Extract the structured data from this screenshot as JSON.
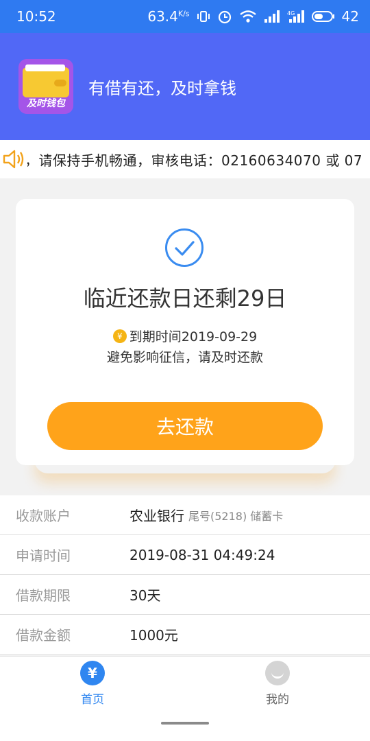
{
  "status_bar": {
    "time": "10:52",
    "network_speed": "63.4",
    "speed_unit": "K/s",
    "battery": "42"
  },
  "header": {
    "logo_text": "及时钱包",
    "slogan": "有借有还，及时拿钱"
  },
  "notice": {
    "text": "，请保持手机畅通，审核电话：02160634070 或 07"
  },
  "card": {
    "title": "临近还款日还剩29日",
    "due_label": "到期时间2019-09-29",
    "warning": "避免影响征信，请及时还款",
    "repay_button": "去还款"
  },
  "info": {
    "rows": [
      {
        "label": "收款账户",
        "value": "农业银行",
        "sub": "尾号(5218) 储蓄卡"
      },
      {
        "label": "申请时间",
        "value": "2019-08-31 04:49:24",
        "sub": ""
      },
      {
        "label": "借款期限",
        "value": "30天",
        "sub": ""
      },
      {
        "label": "借款金额",
        "value": "1000元",
        "sub": ""
      }
    ]
  },
  "nav": {
    "home_icon_glyph": "¥",
    "home_label": "首页",
    "mine_label": "我的"
  },
  "colors": {
    "status_bar": "#2f7af1",
    "header": "#5168f6",
    "accent": "#ffa31a",
    "nav_active": "#2f86f0"
  }
}
